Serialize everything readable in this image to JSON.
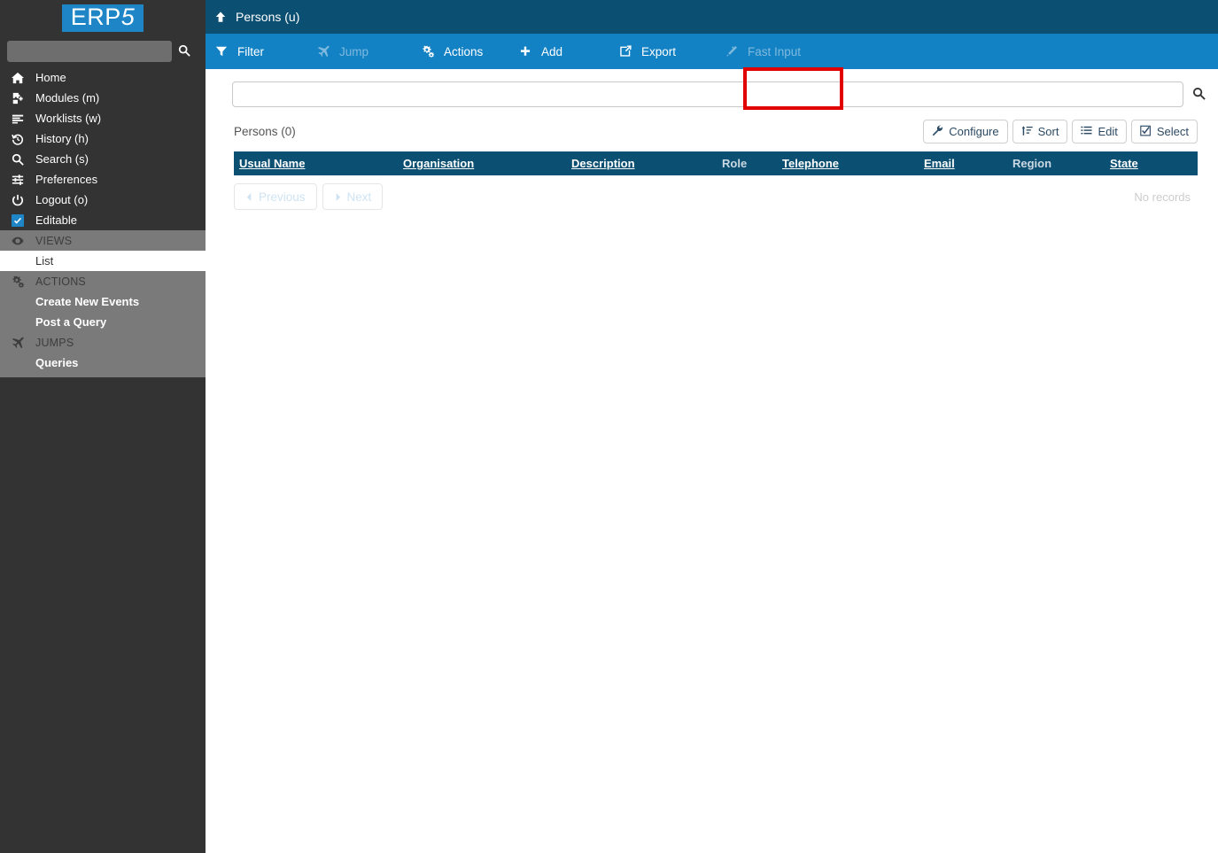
{
  "brand": {
    "name_main": "ERP",
    "name_accent": "5"
  },
  "colors": {
    "sidebar_bg": "#333333",
    "group_bg": "#7a7a7a",
    "topbar_bg": "#0b4f72",
    "actionbar_bg": "#1382c4",
    "accent_blue": "#1e86c7",
    "highlight_red": "#e00000"
  },
  "sidebar": {
    "search": {
      "value": "",
      "placeholder": "",
      "button_label": "search-icon"
    },
    "items": [
      {
        "label": "Home",
        "icon": "home-icon"
      },
      {
        "label": "Modules (m)",
        "icon": "modules-icon"
      },
      {
        "label": "Worklists (w)",
        "icon": "worklists-icon"
      },
      {
        "label": "History (h)",
        "icon": "history-icon"
      },
      {
        "label": "Search (s)",
        "icon": "search-icon"
      },
      {
        "label": "Preferences",
        "icon": "preferences-icon"
      },
      {
        "label": "Logout (o)",
        "icon": "power-icon"
      },
      {
        "label": "Editable",
        "icon": "checkbox-checked-icon"
      }
    ],
    "groups": [
      {
        "title": "VIEWS",
        "icon": "eye-icon",
        "items": [
          {
            "label": "List",
            "selected": true
          }
        ]
      },
      {
        "title": "ACTIONS",
        "icon": "gears-icon",
        "items": [
          {
            "label": "Create New Events",
            "selected": false
          },
          {
            "label": "Post a Query",
            "selected": false
          }
        ]
      },
      {
        "title": "JUMPS",
        "icon": "plane-icon",
        "items": [
          {
            "label": "Queries",
            "selected": false
          }
        ]
      }
    ]
  },
  "topbar": {
    "title": "Persons (u)",
    "icon": "up-arrow-icon"
  },
  "actionbar": {
    "items": [
      {
        "label": "Filter",
        "icon": "funnel-icon",
        "disabled": false,
        "highlighted": false
      },
      {
        "label": "Jump",
        "icon": "plane-icon",
        "disabled": true,
        "highlighted": false
      },
      {
        "label": "Actions",
        "icon": "gears-icon",
        "disabled": false,
        "highlighted": false
      },
      {
        "label": "Add",
        "icon": "plus-icon",
        "disabled": false,
        "highlighted": true
      },
      {
        "label": "Export",
        "icon": "export-icon",
        "disabled": false,
        "highlighted": false
      },
      {
        "label": "Fast Input",
        "icon": "wand-icon",
        "disabled": true,
        "highlighted": false
      }
    ]
  },
  "search": {
    "value": "",
    "placeholder": "",
    "submit_icon": "search-icon"
  },
  "listing": {
    "title": "Persons (0)",
    "buttons": [
      {
        "label": "Configure",
        "icon": "wrench-icon"
      },
      {
        "label": "Sort",
        "icon": "sort-icon"
      },
      {
        "label": "Edit",
        "icon": "list-icon"
      },
      {
        "label": "Select",
        "icon": "check-square-icon"
      }
    ],
    "columns": [
      {
        "label": "Usual Name",
        "sortable": true
      },
      {
        "label": "Organisation",
        "sortable": true
      },
      {
        "label": "Description",
        "sortable": true
      },
      {
        "label": "Role",
        "sortable": false
      },
      {
        "label": "Telephone",
        "sortable": true
      },
      {
        "label": "Email",
        "sortable": true
      },
      {
        "label": "Region",
        "sortable": false
      },
      {
        "label": "State",
        "sortable": true
      }
    ],
    "rows": [],
    "empty_text": "No records",
    "pagination": {
      "previous_label": "Previous",
      "next_label": "Next",
      "previous_disabled": true,
      "next_disabled": true
    }
  }
}
